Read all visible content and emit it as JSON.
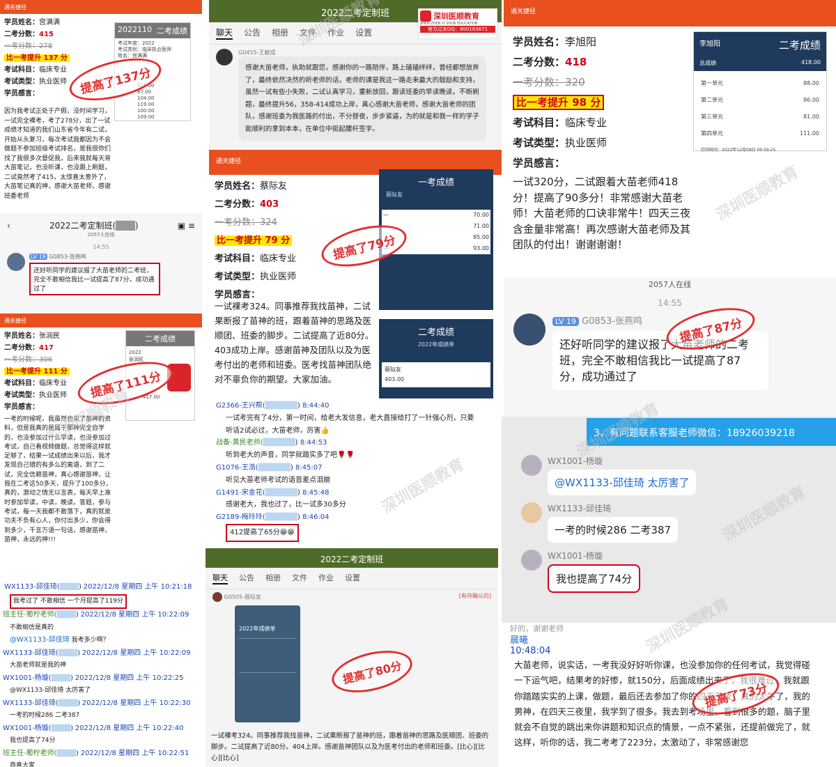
{
  "p1": {
    "hdr": "通关捷径",
    "name_l": "学员姓名：",
    "name": "宫满满",
    "s2_l": "二考分数：",
    "s2": "415",
    "s1_l": "一考分数：",
    "s1": "278",
    "up": "比一考提升 137 分",
    "subj_l": "考试科目：",
    "subj": "临床专业",
    "type_l": "考试类型：",
    "type": "执业医师",
    "feel_l": "学员感言：",
    "feel": "因为我考试正处于产假，没时间学习，一试完全裸考，考了278分，出了一试成绩才知道的我们山东省今年有二试，开始从头复习，每次考试我都因为不会做题不参加班级考试排名，是我很你们找了我很多次督促我，后来我就每天背大苗笔记，也没听课，也没跟上刷题，二试竟然考了415，太惊喜太意外了，大苗笔记真的神，感谢大苗老师，感谢班委老师",
    "stamp": "提高了137分",
    "card_t": "二考成绩",
    "card_top": "2022110",
    "card_rows": [
      "考试年度：2022",
      "考试类别：临床执业医师",
      "姓名：宫满满"
    ],
    "card_scores": [
      "115.00",
      "87.00",
      "104.00",
      "119.00",
      "100.00",
      "109.00"
    ]
  },
  "p2": {
    "title": "2022二考定制班",
    "tabs": [
      "聊天",
      "公告",
      "相册",
      "文件",
      "作业",
      "设置"
    ],
    "user": "G0455-王献成",
    "msg": "感谢大苗老师，执助就跟您，感谢你的一路陪伴，路上磕磕绊绊，曾经都想放弃了，最终依然决然的听老师的话，老师的课是我这一路走来最大的鼓励和支持，虽然一试有些小失败，二试认真学习，重新放回，跟读班委的早读晚读，不断刷题，最终提升56，358-414成功上岸，真心感谢大苗老师，感谢大苗老师的团队，感谢班委为我医路的付出，不分昼夜，步步紧逼，为的就是和我一样的学子能顺利的拿到本本，在单位中挺起腰杆签字。",
    "logo": "深圳医顺教育",
    "logo_en": "SHEN ZHEN YI SHUN EDUCATION",
    "logo_qq": "官方过关QQ：800183671"
  },
  "p3": {
    "hdr": "通关捷径",
    "name_l": "学员姓名：",
    "name": "李旭阳",
    "s2_l": "二考分数：",
    "s2": "418",
    "s1_l": "一考分数：",
    "s1": "320",
    "up": "比一考提升 98 分",
    "subj_l": "考试科目：",
    "subj": "临床专业",
    "type_l": "考试类型：",
    "type": "执业医师",
    "feel_l": "学员感言：",
    "feel": "一试320分，二试跟着大苗老师418分！提高了90多分！非常感谢大苗老师！大苗老师的口诀非常牛！四天三夜含金量非常高！再次感谢大苗老师及其团队的付出！谢谢谢谢！",
    "card_t": "二考成绩",
    "card_name": "李旭阳",
    "total_l": "总成绩",
    "total": "418.00",
    "units": [
      [
        "第一单元",
        "88.00"
      ],
      [
        "第二单元",
        "86.00"
      ],
      [
        "第三单元",
        "81.00"
      ],
      [
        "第四单元",
        "111.00"
      ]
    ],
    "date": "打印时间：2022年12月08日 09:59:25"
  },
  "p4": {
    "title": "2022二考定制班(",
    "title_end": ")",
    "online": "2057人在线",
    "time": "14:55",
    "lv": "LV 19",
    "user": "G0853-张燕鸣",
    "msg": "还好听同学的建议报了大苗老师的二考班，完全不敢相信我比一试提高了87分，成功通过了"
  },
  "p5": {
    "hdr": "通关捷径",
    "name_l": "学员姓名：",
    "name": "蔡际友",
    "s2_l": "二考分数：",
    "s2": "403",
    "s1_l": "一考分数：",
    "s1": "324",
    "up": "比一考提升 79 分",
    "subj_l": "考试科目：",
    "subj": "临床专业",
    "type_l": "考试类型：",
    "type": "执业医师",
    "feel_l": "学员感言：",
    "feel": "一试裸考324。同事推荐我找苗神，二试果断报了苗神的班，跟着苗神的思路及医顺团、班委的脚步。二试提高了近80分。403成功上岸。感谢苗神及团队以及为医考付出的老师和班委。医考找苗神团队绝对不辜负你的期望。大家加油。",
    "stamp": "提高了79分",
    "card_t": "一考成绩",
    "card_name": "蔡际友",
    "card_scores": [
      "70.00",
      "71.00",
      "85.00",
      "93.00"
    ],
    "card2_t": "二考成绩",
    "card2_name": "蔡际友",
    "card2_total": "403.00",
    "card2_header": "2022年成绩单"
  },
  "p6": {
    "hdr": "通关捷径",
    "name_l": "学员姓名：",
    "name": "张润民",
    "s2_l": "二考分数：",
    "s2": "417",
    "s1_l": "一考分数：",
    "s1": "306",
    "up": "比一考提升 111 分",
    "subj_l": "考试科目：",
    "subj": "临床专业",
    "type_l": "考试类型：",
    "type": "执业医师",
    "feel_l": "学员感言：",
    "feel": "一考的时候呢，我虽然也买了苗神的资料，但是我真的是属于那种完全自学的，也没参加过什么早读，也没参加过考试，自己看视频做题，总觉得这样就足够了，结果一试成绩出来以后，我才发现自己错的有多么的离谱，到了二试，完全信赖苗神，真心感谢苗神，让我在二考这50多天，提升了100多分，真的，激动之情无以言表，每天早上准时参加早读，中读，晚读，答题，参与考试，每一天我都不敢落下，真的就是功夫不负有心人，你付出多少，你会得到多少，千言万语一句话，感谢苗神，苗神，永远的神!!!",
    "stamp": "提高了111分",
    "card_t": "二考成绩",
    "card_rows": [
      "2022",
      "张润民"
    ],
    "card_scores": [
      "417.00"
    ]
  },
  "p7": {
    "msgs": [
      {
        "n": "G2366-王兴帮(",
        "t": "8:44:40",
        "m": "一试考完有了4分，第一时间，给老大发信息，老大直接给打了一针强心剂，只要听话2试必过，大苗老师，厉害👍"
      },
      {
        "n": "战备-黄民老师(",
        "t": "8:44:53",
        "m": "听到老大的声音，同学就踏实多了吧🌹🌹",
        "g": true
      },
      {
        "n": "G1076-王浩(",
        "t": "8:45:07",
        "m": "听见大苗老师考试的语音差点泪崩"
      },
      {
        "n": "G1491-宋金花(",
        "t": "8:45:48",
        "m": "感谢老大，我也过了，比一试多30多分"
      },
      {
        "n": "G2189-梅玲玲(",
        "t": "8:46:04",
        "m": "412提高了65分😁😁"
      }
    ]
  },
  "p8": {
    "online": "2057人在线",
    "time": "14:55",
    "lv": "LV 19",
    "user": "G0853-张燕鸣",
    "msg": "还好听同学的建议报了大苗老师的二考班，完全不敢相信我比一试提高了87分，成功通过了",
    "stamp": "提高了87分"
  },
  "p9": {
    "msgs": [
      {
        "n": "WX1133-邱佳琦(",
        "d": "2022/12/8 星期四 上午 10:21:18",
        "m": "我考过了  不敢相信 一个月提高了119分",
        "box": true
      },
      {
        "n": "班主任-葡柠老师(",
        "d": "2022/12/8 星期四 上午 10:22:09",
        "m": "不敢相信是真的",
        "g": true
      },
      {
        "n": "@WX1133-邱佳琦",
        "d": "",
        "m": "我考多少啊？",
        "at": true
      },
      {
        "n": "WX1133-邱佳琦(",
        "d": "2022/12/8 星期四 上午 10:22:09",
        "m": "大苗老师就是我的神"
      },
      {
        "n": "WX1001-杨璇(",
        "d": "2022/12/8 星期四 上午 10:22:25",
        "m": "@WX1133-邱佳琦 太厉害了"
      },
      {
        "n": "WX1133-邱佳琦(",
        "d": "2022/12/8 星期四 上午 10:22:30",
        "m": "一考的时候286  二考387"
      },
      {
        "n": "WX1001-杨璇(",
        "d": "2022/12/8 星期四 上午 10:22:40",
        "m": "我也提高了74分"
      },
      {
        "n": "班主任-葡柠老师(",
        "d": "2022/12/8 星期四 上午 10:22:51",
        "m": "恭喜大家",
        "g": true
      }
    ]
  },
  "p10": {
    "title": "2022二考定制班",
    "tabs": [
      "聊天",
      "公告",
      "相册",
      "文件",
      "作业",
      "设置"
    ],
    "user": "G0505-蔡际友",
    "tag": "[有待确认的]",
    "card_t": "2022年成绩单",
    "msg": "一试裸考324。同事推荐我找苗神，二试果断报了苗神的班，跟着苗神的思路及医顺团、班委的脚步。二试提高了近80分。404上岸。感谢苗神团队以及为医考付出的老师和班委。[比心][比心][比心]",
    "stamp": "提高了80分"
  },
  "p11": {
    "banner": "3，有问题联系客服老师微信：18926039218",
    "msgs": [
      {
        "n": "WX1001-杨璇",
        "m": "@WX1133-邱佳琦 太厉害了"
      },
      {
        "n": "WX1133-邱佳琦",
        "m": "一考的时候286   二考387"
      },
      {
        "n": "WX1001-杨璇",
        "m": "我也提高了74分",
        "box": true
      }
    ]
  },
  "p12": {
    "top": "好的，谢谢老师",
    "name": "晨曦",
    "time": "10:48:04",
    "msg": "大苗老师，说实话，一考我没好好听你课，也没参加你的任何考试，我觉得碰一下运气吧，结果考的好惨，就150分，后面成绩出来了，我很难过，我就跟你踏踏实实的上课，做题，最后还去参加了你的四天三夜，真的太牛了，我的男神，在四天三夜里，我学到了很多。我去到考场里，看到很多的题，脑子里就会不自觉的跳出来你讲题和知识点的情景，一点不紧张，还提前做完了，就这样，听你的话，我二考考了223分，太激动了，非常感谢您",
    "stamp": "提高了73分"
  },
  "wm": "深圳医顺教育"
}
